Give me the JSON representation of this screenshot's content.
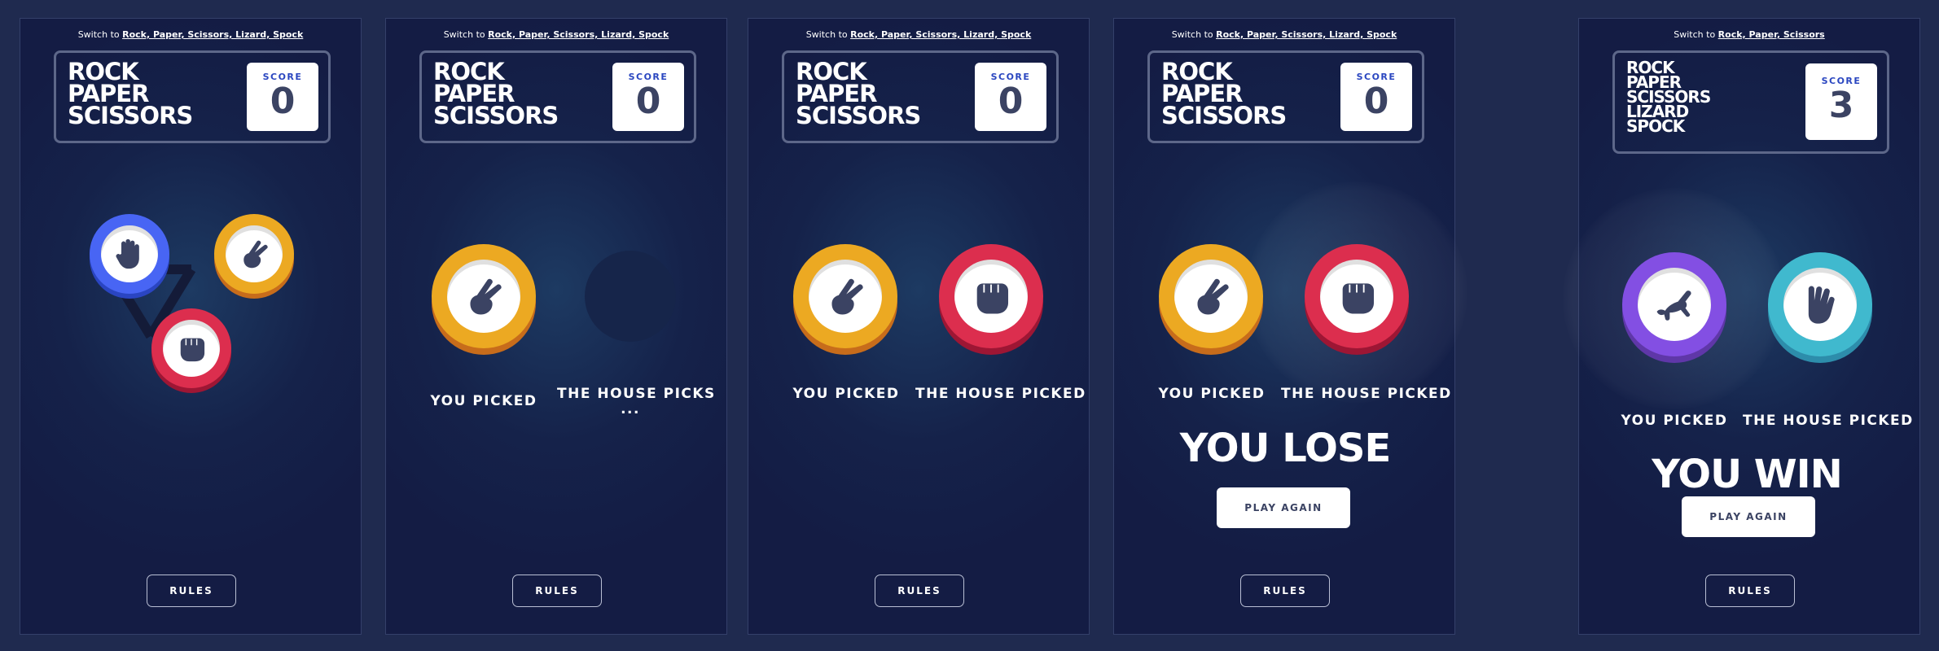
{
  "colors": {
    "rock": "#dc2e4e",
    "paper": "#4865f4",
    "scissors": "#eca922",
    "lizard": "#834fe3",
    "spock": "#40b9ce",
    "score_text": "#2a46c0",
    "dark_text": "#3b4363"
  },
  "panels": [
    {
      "switch_prefix": "Switch to ",
      "switch_link": "Rock, Paper, Scissors, Lizard, Spock",
      "title_lines": [
        "ROCK",
        "PAPER",
        "SCISSORS"
      ],
      "score_label": "SCORE",
      "score": "0",
      "tokens": [
        {
          "type": "paper",
          "icon": "paper-hand-icon"
        },
        {
          "type": "scissors",
          "icon": "scissors-hand-icon"
        },
        {
          "type": "rock",
          "icon": "rock-fist-icon"
        }
      ],
      "rules_label": "RULES"
    },
    {
      "switch_prefix": "Switch to ",
      "switch_link": "Rock, Paper, Scissors, Lizard, Spock",
      "title_lines": [
        "ROCK",
        "PAPER",
        "SCISSORS"
      ],
      "score_label": "SCORE",
      "score": "0",
      "you_label": "YOU PICKED",
      "house_label": "THE HOUSE PICKS",
      "house_dots": "...",
      "rules_label": "RULES"
    },
    {
      "switch_prefix": "Switch to ",
      "switch_link": "Rock, Paper, Scissors, Lizard, Spock",
      "title_lines": [
        "ROCK",
        "PAPER",
        "SCISSORS"
      ],
      "score_label": "SCORE",
      "score": "0",
      "you_label": "YOU PICKED",
      "house_label": "THE HOUSE PICKED",
      "rules_label": "RULES"
    },
    {
      "switch_prefix": "Switch to ",
      "switch_link": "Rock, Paper, Scissors, Lizard, Spock",
      "title_lines": [
        "ROCK",
        "PAPER",
        "SCISSORS"
      ],
      "score_label": "SCORE",
      "score": "0",
      "you_label": "YOU PICKED",
      "house_label": "THE HOUSE PICKED",
      "result": "YOU LOSE",
      "play_again": "PLAY AGAIN",
      "rules_label": "RULES"
    },
    {
      "switch_prefix": "Switch to ",
      "switch_link": "Rock, Paper, Scissors",
      "title_lines": [
        "ROCK",
        "PAPER",
        "SCISSORS",
        "LIZARD",
        "SPOCK"
      ],
      "score_label": "SCORE",
      "score": "3",
      "you_label": "YOU PICKED",
      "house_label": "THE HOUSE PICKED",
      "result": "YOU WIN",
      "play_again": "PLAY AGAIN",
      "rules_label": "RULES"
    }
  ]
}
